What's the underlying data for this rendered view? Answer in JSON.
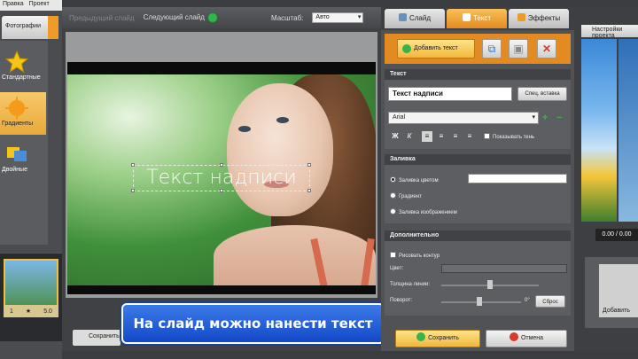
{
  "menu": {
    "items": [
      "Правка",
      "Проект"
    ]
  },
  "left": {
    "tab_label": "Фотографии",
    "categories": [
      {
        "label": "Стандартные",
        "icon": "star-icon"
      },
      {
        "label": "Градиенты",
        "icon": "gradient-icon"
      },
      {
        "label": "Двойные",
        "icon": "double-icon"
      }
    ],
    "thumb_bar": [
      "1",
      "★",
      "5.0"
    ]
  },
  "editor": {
    "prev_slide": "Предыдущий слайд",
    "next_slide": "Следующий слайд",
    "scale_label": "Масштаб:",
    "scale_value": "Авто",
    "overlay_text": "Текст надписи",
    "caption": "На слайд можно нанести текст",
    "save_label": "Сохранить"
  },
  "props": {
    "tabs": [
      "Слайд",
      "Текст",
      "Эффекты"
    ],
    "add_text": "Добавить текст",
    "section_text": "Текст",
    "text_value": "Текст надписи",
    "special_insert": "Спец. вставка",
    "font_value": "Arial",
    "shadow_label": "Показывать тень",
    "section_fill": "Заливка",
    "fill_options": [
      "Заливка цветом",
      "Градиент",
      "Заливка изображением"
    ],
    "section_extra": "Дополнительно",
    "outline_label": "Рисовать контур",
    "color_label": "Цвет:",
    "thickness_label": "Толщина линии:",
    "rotate_label": "Поворот:",
    "rotate_value": "0°",
    "reset": "Сброс",
    "save": "Сохранить",
    "cancel": "Отмена"
  },
  "far": {
    "settings": "Настройки проекта",
    "time": "0.00 / 0.00",
    "add_label": "Добавить"
  },
  "colors": {
    "accent": "#e58a1f",
    "caption": "#1449c8",
    "green": "#37b24d",
    "red": "#d83a2a"
  }
}
